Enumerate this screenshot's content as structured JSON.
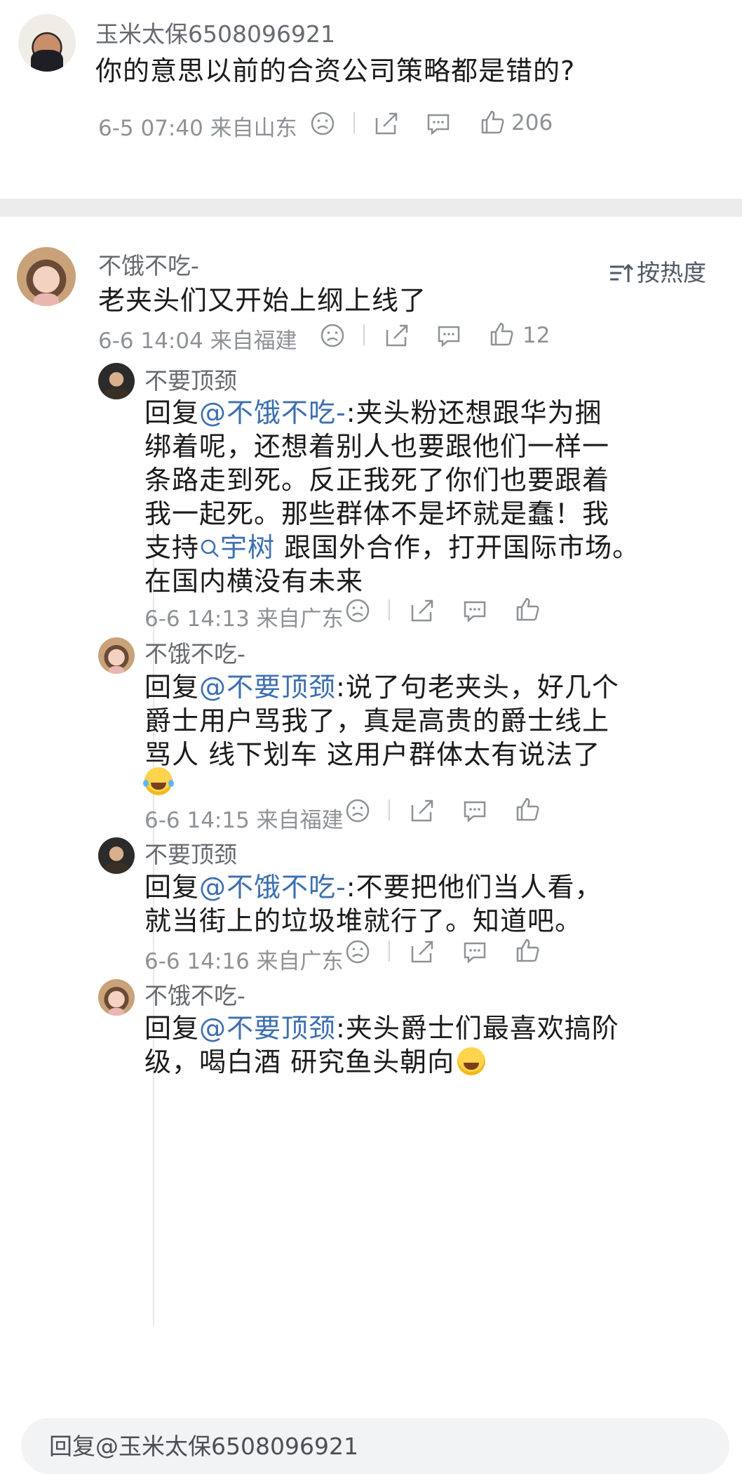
{
  "top_comment": {
    "username": "玉米太保6508096921",
    "text": "你的意思以前的合资公司策略都是错的?",
    "meta": "6-5 07:40 来自山东",
    "likes": "206"
  },
  "sort": {
    "label": "按热度"
  },
  "main_comment": {
    "username": "不饿不吃-",
    "text": "老夹头们又开始上纲上线了",
    "meta": "6-6 14:04 来自福建",
    "likes": "12"
  },
  "replies": [
    {
      "username": "不要顶颈",
      "prefix": "回复",
      "mention": "@不饿不吃-",
      "lines": [
        ":夹头粉还想跟华为捆",
        "绑着呢，还想着别人也要跟他们一样一",
        "条路走到死。反正我死了你们也要跟着",
        "我一起死。那些群体不是坏就是蠢！我",
        "在国内横没有未来"
      ],
      "line5_pre": "支持",
      "line5_link": "宇树",
      "line5_post": " 跟国外合作，打开国际市场。",
      "meta": "6-6 14:13 来自广东"
    },
    {
      "username": "不饿不吃-",
      "prefix": "回复",
      "mention": "@不要顶颈",
      "lines": [
        ":说了句老夹头，好几个",
        "爵士用户骂我了，真是高贵的爵士线上",
        "骂人 线下划车 这用户群体太有说法了"
      ],
      "meta": "6-6 14:15 来自福建"
    },
    {
      "username": "不要顶颈",
      "prefix": "回复",
      "mention": "@不饿不吃-",
      "lines": [
        ":不要把他们当人看，",
        "就当街上的垃圾堆就行了。知道吧。"
      ],
      "meta": "6-6 14:16 来自广东"
    },
    {
      "username": "不饿不吃-",
      "prefix": "回复",
      "mention": "@不要顶颈",
      "lines": [
        ":夹头爵士们最喜欢搞阶",
        "级，喝白酒 研究鱼头朝向"
      ]
    }
  ],
  "reply_bar": {
    "placeholder": "回复@玉米太保6508096921"
  },
  "colors": {
    "mention": "#3d6fb0",
    "meta": "#8e9297",
    "underline": "#e0202a"
  }
}
